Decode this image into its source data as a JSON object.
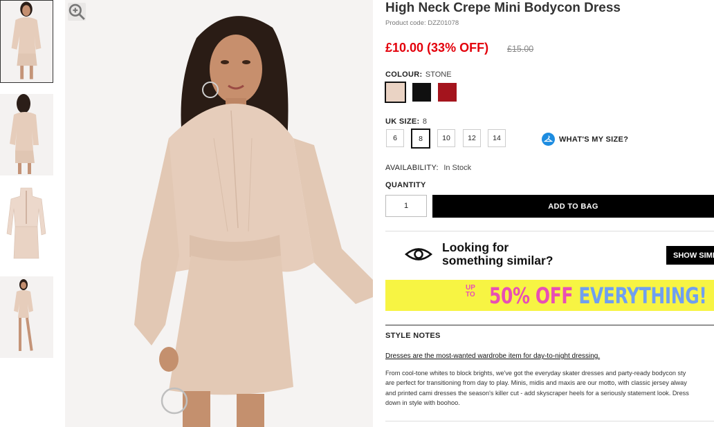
{
  "thumbnails": [
    {
      "label": "Thumbnail 1",
      "active": true
    },
    {
      "label": "Thumbnail 2",
      "active": false
    },
    {
      "label": "Thumbnail 3",
      "active": false
    },
    {
      "label": "Thumbnail 4",
      "active": false
    }
  ],
  "product": {
    "title": "High Neck Crepe Mini Bodycon Dress",
    "code": "Product code: DZZ01078",
    "price": "£10.00 (33% OFF)",
    "old_price": "£15.00"
  },
  "colour": {
    "label": "COLOUR:",
    "value": "STONE",
    "swatches": [
      {
        "name": "stone",
        "color": "#ead3c4",
        "selected": true
      },
      {
        "name": "black",
        "color": "#101010",
        "selected": false
      },
      {
        "name": "red",
        "color": "#a4141d",
        "selected": false
      }
    ]
  },
  "size": {
    "label": "UK SIZE:",
    "value": "8",
    "options": [
      "6",
      "8",
      "10",
      "12",
      "14"
    ],
    "selected": "8",
    "help_label": "WHAT'S MY SIZE?"
  },
  "availability": {
    "label": "AVAILABILITY:",
    "value": "In Stock"
  },
  "quantity": {
    "label": "QUANTITY",
    "value": "1"
  },
  "add_to_bag": "ADD TO BAG",
  "similar": {
    "line1": "Looking for",
    "line2": "something similar?",
    "button": "SHOW SIMI"
  },
  "promo": {
    "upto": "UP TO",
    "percent": "50% OFF",
    "rest": " EVERYTHING!"
  },
  "style_notes": {
    "label": "STYLE NOTES",
    "headline": "Dresses are the most-wanted wardrobe item for day-to-night dressing.",
    "lines": [
      "From cool-tone whites to block brights, we've got the everyday skater dresses and party-ready bodycon sty",
      "are perfect for transitioning from day to play. Minis, midis and maxis are our motto, with classic jersey alway",
      "and printed cami dresses the season's killer cut - add skyscraper heels for a seriously statement look. Dress",
      "down in style with boohoo."
    ]
  },
  "colors": {
    "price_red": "#e3000b",
    "promo_yellow": "#f7f443",
    "promo_pink": "#e84fb4",
    "promo_blue": "#6f9ff0",
    "size_help_blue": "#1d8ce0",
    "dress": "#e6cdbb"
  }
}
